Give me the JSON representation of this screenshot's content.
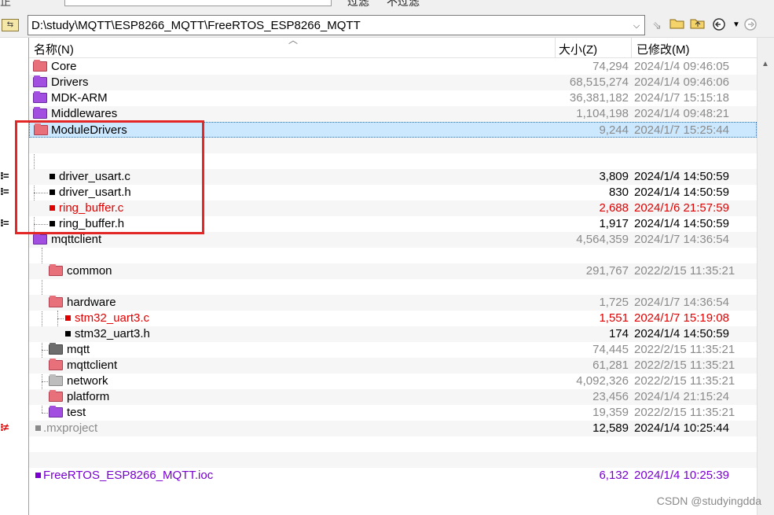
{
  "topbar": {
    "left_fragment": "正",
    "filter_label": "过滤",
    "nofilter_label": "不过滤"
  },
  "toolbar": {
    "path": "D:\\study\\MQTT\\ESP8266_MQTT\\FreeRTOS_ESP8266_MQTT",
    "left_icon": "folder-swap-icon",
    "buttons": [
      "swap-arrow-icon",
      "open-folder-icon",
      "up-folder-icon",
      "back-icon",
      "dropdown-icon",
      "forward-icon"
    ]
  },
  "columns": {
    "name": "名称(N)",
    "size": "大小(Z)",
    "modified": "已修改(M)"
  },
  "rows": [
    {
      "name": "Core",
      "size": "74,294",
      "date": "2024/1/4 09:46:05"
    },
    {
      "name": "Drivers",
      "size": "68,515,274",
      "date": "2024/1/4 09:46:06"
    },
    {
      "name": "MDK-ARM",
      "size": "36,381,182",
      "date": "2024/1/7 15:15:18"
    },
    {
      "name": "Middlewares",
      "size": "1,104,198",
      "date": "2024/1/4 09:48:21"
    },
    {
      "name": "ModuleDrivers",
      "size": "9,244",
      "date": "2024/1/7 15:25:44"
    },
    {
      "name": "",
      "size": "",
      "date": ""
    },
    {
      "name": "",
      "size": "",
      "date": ""
    },
    {
      "name": "driver_usart.c",
      "size": "3,809",
      "date": "2024/1/4 14:50:59"
    },
    {
      "name": "driver_usart.h",
      "size": "830",
      "date": "2024/1/4 14:50:59"
    },
    {
      "name": "ring_buffer.c",
      "size": "2,688",
      "date": "2024/1/6 21:57:59"
    },
    {
      "name": "ring_buffer.h",
      "size": "1,917",
      "date": "2024/1/4 14:50:59"
    },
    {
      "name": "mqttclient",
      "size": "4,564,359",
      "date": "2024/1/7 14:36:54"
    },
    {
      "name": "",
      "size": "",
      "date": ""
    },
    {
      "name": "common",
      "size": "291,767",
      "date": "2022/2/15 11:35:21"
    },
    {
      "name": "",
      "size": "",
      "date": ""
    },
    {
      "name": "hardware",
      "size": "1,725",
      "date": "2024/1/7 14:36:54"
    },
    {
      "name": "stm32_uart3.c",
      "size": "1,551",
      "date": "2024/1/7 15:19:08"
    },
    {
      "name": "stm32_uart3.h",
      "size": "174",
      "date": "2024/1/4 14:50:59"
    },
    {
      "name": "mqtt",
      "size": "74,445",
      "date": "2022/2/15 11:35:21"
    },
    {
      "name": "mqttclient",
      "size": "61,281",
      "date": "2022/2/15 11:35:21"
    },
    {
      "name": "network",
      "size": "4,092,326",
      "date": "2022/2/15 11:35:21"
    },
    {
      "name": "platform",
      "size": "23,456",
      "date": "2024/1/4 21:15:24"
    },
    {
      "name": "test",
      "size": "19,359",
      "date": "2022/2/15 11:35:21"
    },
    {
      "name": ".mxproject",
      "size": "12,589",
      "date": "2024/1/4 10:25:44"
    },
    {
      "name": "",
      "size": "",
      "date": ""
    },
    {
      "name": "",
      "size": "",
      "date": ""
    },
    {
      "name": "FreeRTOS_ESP8266_MQTT.ioc",
      "size": "6,132",
      "date": "2024/1/4 10:25:39"
    }
  ],
  "gutter": {
    "equal_mark": "=",
    "notequal_mark": "≠"
  },
  "colors": {
    "red_text": "#e00000",
    "purple_text": "#7a00d0",
    "gray_text": "#8a8a8a",
    "selection": "#cce8ff",
    "highlight_box": "#e32626"
  },
  "watermark": "CSDN @studyingdda"
}
